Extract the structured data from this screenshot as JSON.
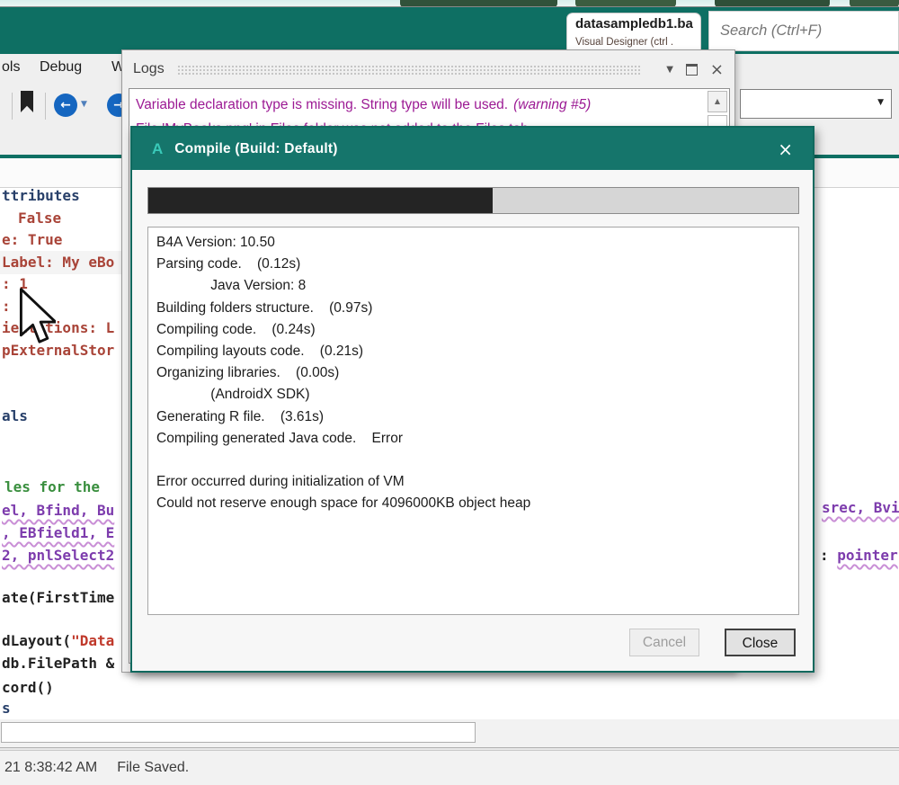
{
  "window": {
    "tab_title": "datasampledb1.ba",
    "tab_subtitle": "Visual Designer  (ctrl .",
    "search_placeholder": "Search (Ctrl+F)"
  },
  "menu": {
    "items": [
      "ols",
      "Debug",
      "W"
    ]
  },
  "toolbar": {
    "back_arrow": "←",
    "forward_arrow": "→",
    "caret": "▼"
  },
  "logs_panel": {
    "title": "Logs",
    "minimize_glyph": "▼",
    "close_glyph": "×",
    "scroll_up_glyph": "▲",
    "rows": [
      {
        "text": "Variable declaration type is missing. String type will be used.",
        "note": "(warning #5)"
      },
      {
        "text": "File 'MyBooks.png' in Files folder was not added to the Files tab.",
        "note": ""
      }
    ]
  },
  "dialog": {
    "logo": "A",
    "title": "Compile (Build: Default)",
    "close_glyph": "×",
    "progress_percent": 53,
    "log_lines": [
      "B4A Version: 10.50",
      "Parsing code.    (0.12s)",
      "              Java Version: 8",
      "Building folders structure.    (0.97s)",
      "Compiling code.    (0.24s)",
      "Compiling layouts code.    (0.21s)",
      "Organizing libraries.    (0.00s)",
      "              (AndroidX SDK)",
      "Generating R file.    (3.61s)",
      "Compiling generated Java code.    Error",
      "",
      "Error occurred during initialization of VM",
      "Could not reserve enough space for 4096000KB object heap"
    ],
    "cancel_label": "Cancel",
    "close_label": "Close"
  },
  "editor": {
    "left_lines": [
      {
        "text": "ttributes"
      },
      {
        "text": "False"
      },
      {
        "text": "e: True"
      },
      {
        "text": "Label: My eBo"
      },
      {
        "text": ": 1"
      },
      {
        "text": ":"
      },
      {
        "text": "ientations: L"
      },
      {
        "text": "pExternalStor"
      },
      {
        "text": "als"
      },
      {
        "text": "les for the"
      },
      {
        "text": "el, Bfind, Bu"
      },
      {
        "text": ", EBfield1, E"
      },
      {
        "text": "2, pnlSelect2"
      },
      {
        "text": "ate(FirstTime"
      },
      {
        "pre": "dLayout(",
        "str": "\"Data"
      },
      {
        "text": "db.FilePath &"
      },
      {
        "text": "cord()"
      },
      {
        "text": "s"
      }
    ],
    "right_lines": [
      {
        "text": "srec, Bvi"
      },
      {
        "pre": ": ",
        "var": "pointer"
      }
    ]
  },
  "statusbar": {
    "time": "21 8:38:42 AM",
    "message": "File Saved."
  },
  "colors": {
    "accent_teal": "#0E6F63",
    "dialog_title_teal": "#15756B",
    "warning_magenta": "#9C1A94",
    "progress_fill": "#242424"
  }
}
